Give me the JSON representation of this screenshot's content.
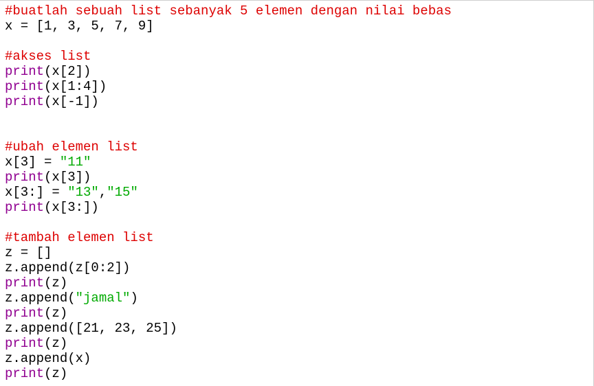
{
  "colors": {
    "background": "#ffffff",
    "comment": "#dd0000",
    "builtin": "#900090",
    "string": "#00aa00",
    "default": "#000000",
    "current_line": "#ffffdd"
  },
  "lines": [
    [
      {
        "t": "comment",
        "v": "#buatlah sebuah list sebanyak 5 elemen dengan nilai bebas"
      }
    ],
    [
      {
        "t": "default",
        "v": "x = [1, 3, 5, 7, 9]"
      }
    ],
    [],
    [
      {
        "t": "comment",
        "v": "#akses list"
      }
    ],
    [
      {
        "t": "builtin",
        "v": "print"
      },
      {
        "t": "default",
        "v": "(x[2])"
      }
    ],
    [
      {
        "t": "builtin",
        "v": "print"
      },
      {
        "t": "default",
        "v": "(x[1:4])"
      }
    ],
    [
      {
        "t": "builtin",
        "v": "print"
      },
      {
        "t": "default",
        "v": "(x[-1])"
      }
    ],
    [],
    [],
    [
      {
        "t": "comment",
        "v": "#ubah elemen list"
      }
    ],
    [
      {
        "t": "default",
        "v": "x[3] = "
      },
      {
        "t": "string",
        "v": "\"11\""
      }
    ],
    [
      {
        "t": "builtin",
        "v": "print"
      },
      {
        "t": "default",
        "v": "(x[3])"
      }
    ],
    [
      {
        "t": "default",
        "v": "x[3:] = "
      },
      {
        "t": "string",
        "v": "\"13\""
      },
      {
        "t": "default",
        "v": ","
      },
      {
        "t": "string",
        "v": "\"15\""
      }
    ],
    [
      {
        "t": "builtin",
        "v": "print"
      },
      {
        "t": "default",
        "v": "(x[3:])"
      }
    ],
    [],
    [
      {
        "t": "comment",
        "v": "#tambah elemen list"
      }
    ],
    [
      {
        "t": "default",
        "v": "z = []"
      }
    ],
    [
      {
        "t": "default",
        "v": "z.append(z[0:2])"
      }
    ],
    [
      {
        "t": "builtin",
        "v": "print"
      },
      {
        "t": "default",
        "v": "(z)"
      }
    ],
    [
      {
        "t": "default",
        "v": "z.append("
      },
      {
        "t": "string",
        "v": "\"jamal\""
      },
      {
        "t": "default",
        "v": ")"
      }
    ],
    [
      {
        "t": "builtin",
        "v": "print"
      },
      {
        "t": "default",
        "v": "(z)"
      }
    ],
    [
      {
        "t": "default",
        "v": "z.append([21, 23, 25])"
      }
    ],
    [
      {
        "t": "builtin",
        "v": "print"
      },
      {
        "t": "default",
        "v": "(z)"
      }
    ],
    [
      {
        "t": "default",
        "v": "z.append(x)"
      }
    ],
    [
      {
        "t": "builtin",
        "v": "print"
      },
      {
        "t": "default",
        "v": "(z)"
      }
    ]
  ]
}
